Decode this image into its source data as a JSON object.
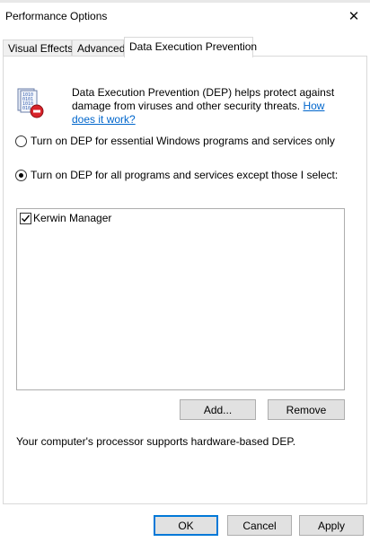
{
  "window": {
    "title": "Performance Options"
  },
  "tabs": [
    {
      "label": "Visual Effects"
    },
    {
      "label": "Advanced"
    },
    {
      "label": "Data Execution Prevention"
    }
  ],
  "dep": {
    "description": "Data Execution Prevention (DEP) helps protect against damage from viruses and other security threats. ",
    "help_link": "How does it work?",
    "option_essential": "Turn on DEP for essential Windows programs and services only",
    "option_all": "Turn on DEP for all programs and services except those I select:",
    "selected_option": "all",
    "exceptions": [
      {
        "name": "Kerwin Manager",
        "checked": true
      }
    ],
    "add_label": "Add...",
    "remove_label": "Remove",
    "status": "Your computer's processor supports hardware-based DEP."
  },
  "footer": {
    "ok_label": "OK",
    "cancel_label": "Cancel",
    "apply_label": "Apply"
  },
  "colors": {
    "link": "#0066cc",
    "primary_border": "#0078d7",
    "button_bg": "#e1e1e1"
  }
}
